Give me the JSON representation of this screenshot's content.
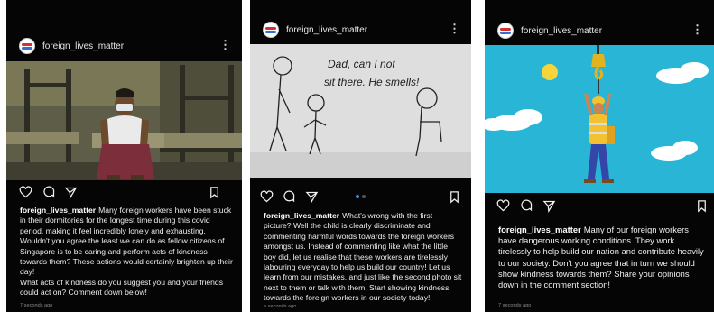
{
  "posts": [
    {
      "username": "foreign_lives_matter",
      "caption_user": "foreign_lives_matter",
      "caption": "Many foreign workers have been stuck in their dormitories for the longest time during this covid period, making it feel incredibly lonely and exhausting. Wouldn't you agree the least we can do as fellow citizens of Singapore is to be caring and perform acts of kindness towards them? These actions would certainly brighten up their day!",
      "caption_extra": "What acts of kindness do you suggest you and your friends could act on? Comment down below!",
      "time": "7 seconds ago"
    },
    {
      "username": "foreign_lives_matter",
      "caption_user": "foreign_lives_matter",
      "caption": "What's wrong with the first picture? Well the child is clearly discriminate and commenting harmful words towards the foreign workers amongst us. Instead of commenting like what the little boy did, let us realise that these workers are tirelessly labouring everyday to help us build our country! Let us learn from our mistakes, and just like the second photo sit next to them or talk with them. Start showing kindness towards the foreign workers in our society today!",
      "drawing_text_line1": "Dad, can I not",
      "drawing_text_line2": "sit there. He smells!",
      "time": "a seconds ago"
    },
    {
      "username": "foreign_lives_matter",
      "caption_user": "foreign_lives_matter",
      "caption": "Many of our foreign workers have dangerous working conditions. They work tirelessly to help build our nation and contribute heavily to our society. Don't you agree that in turn we should show kindness towards them? Share your opinions down in the comment section!",
      "time": "7 seconds ago"
    }
  ],
  "icons": {
    "like": "heart-icon",
    "comment": "comment-icon",
    "share": "send-icon",
    "save": "bookmark-icon",
    "more": "more-vertical-icon"
  },
  "colors": {
    "background": "#050505",
    "text": "#eeeeee",
    "timestamp": "#8a8a8a",
    "carousel_active": "#3b8ee8",
    "sky": "#29b6d6"
  }
}
